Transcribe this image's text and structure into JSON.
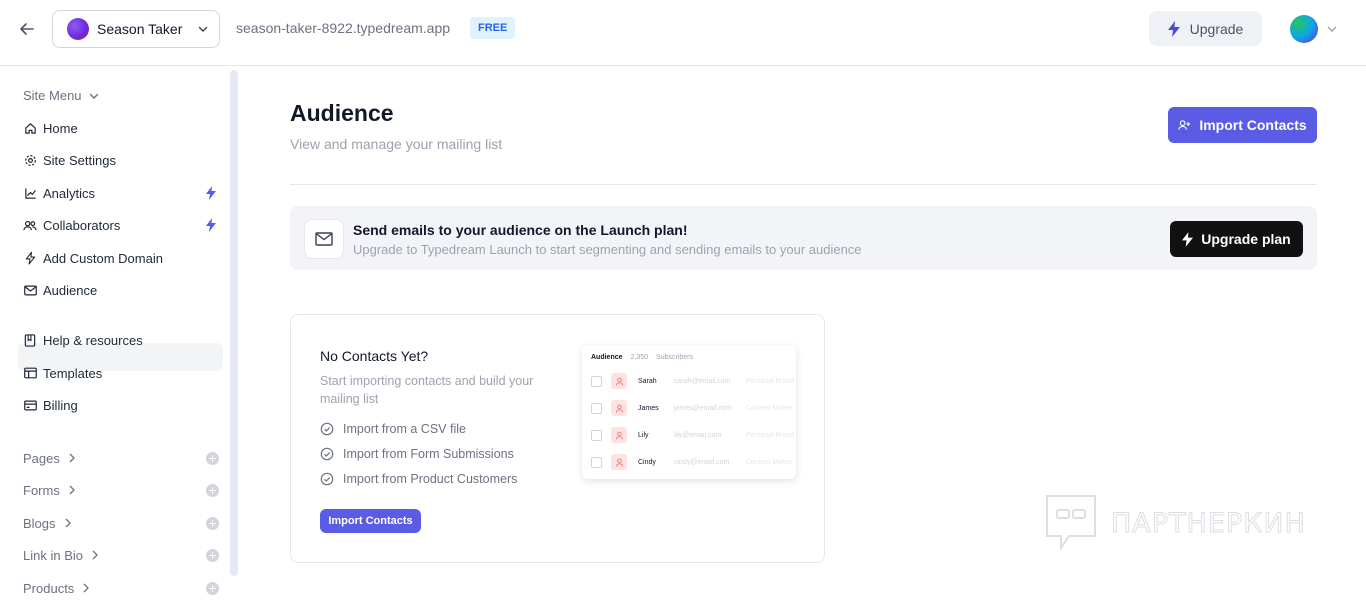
{
  "topbar": {
    "site_name": "Season Taker",
    "domain": "season-taker-8922.typedream.app",
    "plan_badge": "FREE",
    "upgrade_label": "Upgrade"
  },
  "sidebar": {
    "menu_heading": "Site Menu",
    "items": [
      {
        "label": "Home",
        "icon": "home-icon"
      },
      {
        "label": "Site Settings",
        "icon": "gear-icon"
      },
      {
        "label": "Analytics",
        "icon": "chart-icon",
        "premium": true
      },
      {
        "label": "Collaborators",
        "icon": "users-icon",
        "premium": true
      },
      {
        "label": "Add Custom Domain",
        "icon": "bolt-icon"
      },
      {
        "label": "Audience",
        "icon": "mail-icon",
        "active": true
      }
    ],
    "resources": [
      {
        "label": "Help & resources",
        "icon": "book-icon"
      },
      {
        "label": "Templates",
        "icon": "layout-icon"
      },
      {
        "label": "Billing",
        "icon": "card-icon"
      }
    ],
    "groups": [
      {
        "label": "Pages"
      },
      {
        "label": "Forms"
      },
      {
        "label": "Blogs"
      },
      {
        "label": "Link in Bio"
      },
      {
        "label": "Products"
      }
    ]
  },
  "main": {
    "title": "Audience",
    "subtitle": "View and manage your mailing list",
    "import_label": "Import Contacts",
    "banner": {
      "title": "Send emails to your audience on the Launch plan!",
      "subtitle": "Upgrade to Typedream Launch to start segmenting and sending emails to your audience",
      "button_label": "Upgrade plan"
    },
    "empty_card": {
      "title": "No Contacts Yet?",
      "description": "Start importing contacts and build your mailing list",
      "steps": [
        "Import from a CSV file",
        "Import from Form Submissions",
        "Import from Product Customers"
      ],
      "button_label": "Import Contacts",
      "preview": {
        "title": "Audience",
        "count": "2,350",
        "count_label": "Subscribers",
        "rows": [
          {
            "name": "Sarah",
            "email": "sarah@email.com",
            "tag": "Personal Brand"
          },
          {
            "name": "James",
            "email": "james@email.com",
            "tag": "Content Maker"
          },
          {
            "name": "Lily",
            "email": "lily@email.com",
            "tag": "Personal Brand"
          },
          {
            "name": "Cindy",
            "email": "cindy@email.com",
            "tag": "Content Maker"
          }
        ]
      }
    }
  },
  "watermark": "ПАРТНЕРКИН",
  "colors": {
    "accent": "#5b5ce6",
    "premium_bolt": "#5b5ce6",
    "dark_button": "#111111"
  }
}
